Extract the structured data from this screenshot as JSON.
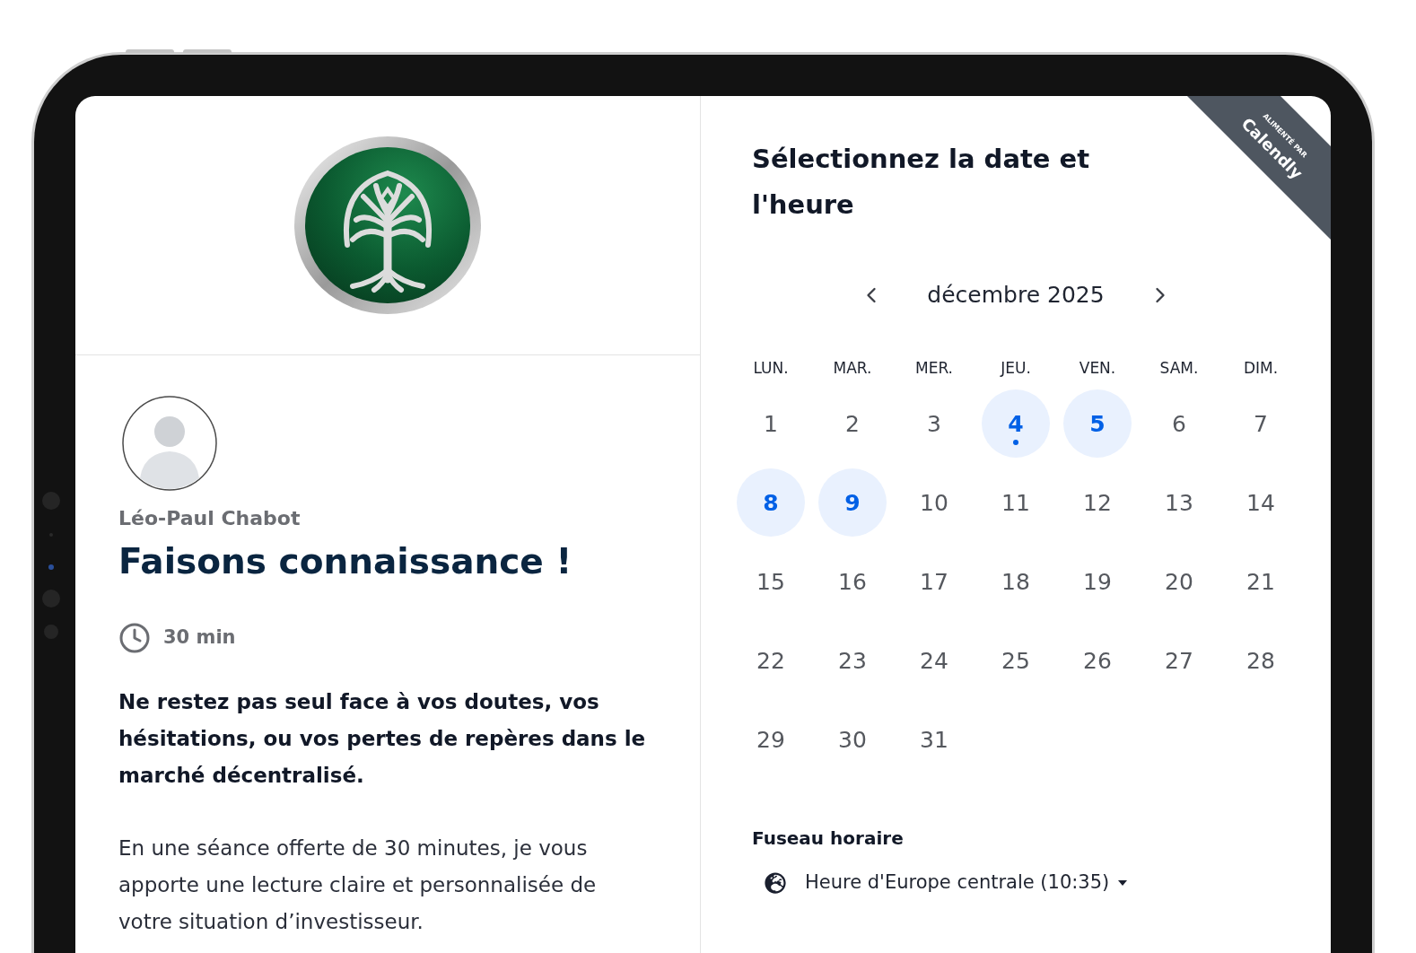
{
  "organizer": {
    "name": "Léo-Paul Chabot"
  },
  "event": {
    "title": "Faisons connaissance !",
    "duration": "30 min",
    "description": [
      {
        "kind": "lead",
        "text": "Ne restez pas seul face à vos doutes, vos hésitations, ou vos pertes de repères dans le marché décentralisé."
      },
      {
        "kind": "body",
        "text": "En une séance offerte de 30 minutes, je vous apporte une lecture claire et personnalisée de votre situation d’investisseur."
      }
    ]
  },
  "scheduler": {
    "title": "Sélectionnez la date et l'heure",
    "month": "décembre 2025",
    "weekdays": [
      "LUN.",
      "MAR.",
      "MER.",
      "JEU.",
      "VEN.",
      "SAM.",
      "DIM."
    ],
    "weeks": [
      [
        {
          "label": "1",
          "available": false,
          "selected": false,
          "today": false
        },
        {
          "label": "2",
          "available": false,
          "selected": false,
          "today": false
        },
        {
          "label": "3",
          "available": false,
          "selected": false,
          "today": false
        },
        {
          "label": "4",
          "available": true,
          "selected": false,
          "today": true
        },
        {
          "label": "5",
          "available": true,
          "selected": false,
          "today": false
        },
        {
          "label": "6",
          "available": false,
          "selected": false,
          "today": false
        },
        {
          "label": "7",
          "available": false,
          "selected": false,
          "today": false
        }
      ],
      [
        {
          "label": "8",
          "available": true,
          "selected": false,
          "today": false
        },
        {
          "label": "9",
          "available": true,
          "selected": false,
          "today": false
        },
        {
          "label": "10",
          "available": false,
          "selected": false,
          "today": false
        },
        {
          "label": "11",
          "available": false,
          "selected": false,
          "today": false
        },
        {
          "label": "12",
          "available": false,
          "selected": false,
          "today": false
        },
        {
          "label": "13",
          "available": false,
          "selected": false,
          "today": false
        },
        {
          "label": "14",
          "available": false,
          "selected": false,
          "today": false
        }
      ],
      [
        {
          "label": "15",
          "available": false,
          "selected": false,
          "today": false
        },
        {
          "label": "16",
          "available": false,
          "selected": false,
          "today": false
        },
        {
          "label": "17",
          "available": false,
          "selected": false,
          "today": false
        },
        {
          "label": "18",
          "available": false,
          "selected": false,
          "today": false
        },
        {
          "label": "19",
          "available": false,
          "selected": false,
          "today": false
        },
        {
          "label": "20",
          "available": false,
          "selected": false,
          "today": false
        },
        {
          "label": "21",
          "available": false,
          "selected": false,
          "today": false
        }
      ],
      [
        {
          "label": "22",
          "available": false,
          "selected": false,
          "today": false
        },
        {
          "label": "23",
          "available": false,
          "selected": false,
          "today": false
        },
        {
          "label": "24",
          "available": false,
          "selected": false,
          "today": false
        },
        {
          "label": "25",
          "available": false,
          "selected": false,
          "today": false
        },
        {
          "label": "26",
          "available": false,
          "selected": false,
          "today": false
        },
        {
          "label": "27",
          "available": false,
          "selected": false,
          "today": false
        },
        {
          "label": "28",
          "available": false,
          "selected": false,
          "today": false
        }
      ],
      [
        {
          "label": "29",
          "available": false,
          "selected": false,
          "today": false
        },
        {
          "label": "30",
          "available": false,
          "selected": false,
          "today": false
        },
        {
          "label": "31",
          "available": false,
          "selected": false,
          "today": false
        }
      ]
    ],
    "timezone": {
      "label": "Fuseau horaire",
      "value": "Heure d'Europe centrale (10:35)"
    }
  },
  "ribbon": {
    "caption": "ALIMENTÉ PAR",
    "brand": "Calendly"
  }
}
